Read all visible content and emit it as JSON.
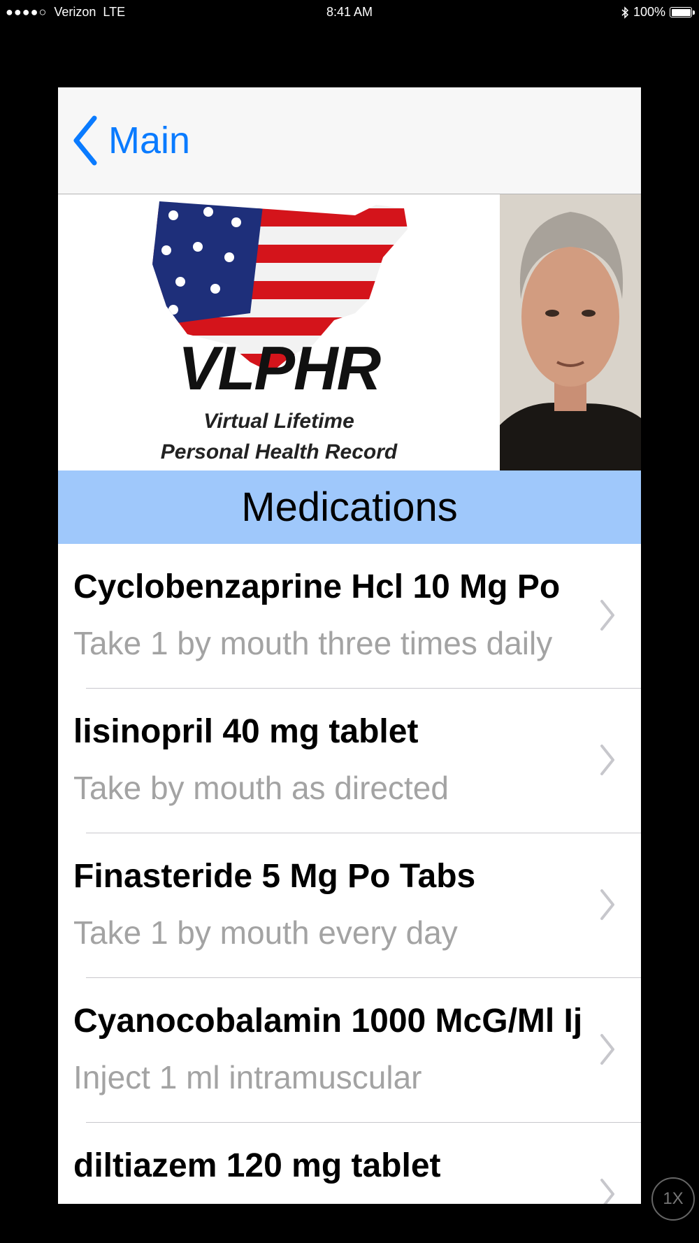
{
  "status_bar": {
    "carrier": "Verizon",
    "network": "LTE",
    "time": "8:41 AM",
    "battery": "100%"
  },
  "nav": {
    "back_label": "Main"
  },
  "banner": {
    "logo_title": "VLPHR",
    "logo_subtitle_line1": "Virtual Lifetime",
    "logo_subtitle_line2": "Personal Health Record"
  },
  "section": {
    "title": "Medications"
  },
  "medications": [
    {
      "name": "Cyclobenzaprine Hcl 10 Mg Po",
      "instructions": "Take 1 by mouth three times daily"
    },
    {
      "name": "lisinopril 40 mg tablet",
      "instructions": "Take by mouth as directed"
    },
    {
      "name": "Finasteride 5 Mg Po Tabs",
      "instructions": "Take 1 by mouth every day"
    },
    {
      "name": "Cyanocobalamin 1000 McG/Ml Ij",
      "instructions": "Inject 1 ml intramuscular"
    },
    {
      "name": "diltiazem 120 mg tablet",
      "instructions": ""
    }
  ],
  "zoom_button": "1X",
  "colors": {
    "accent": "#0a7bff",
    "section_header_bg": "#9fc8fb",
    "subtitle_text": "#a3a3a3"
  }
}
